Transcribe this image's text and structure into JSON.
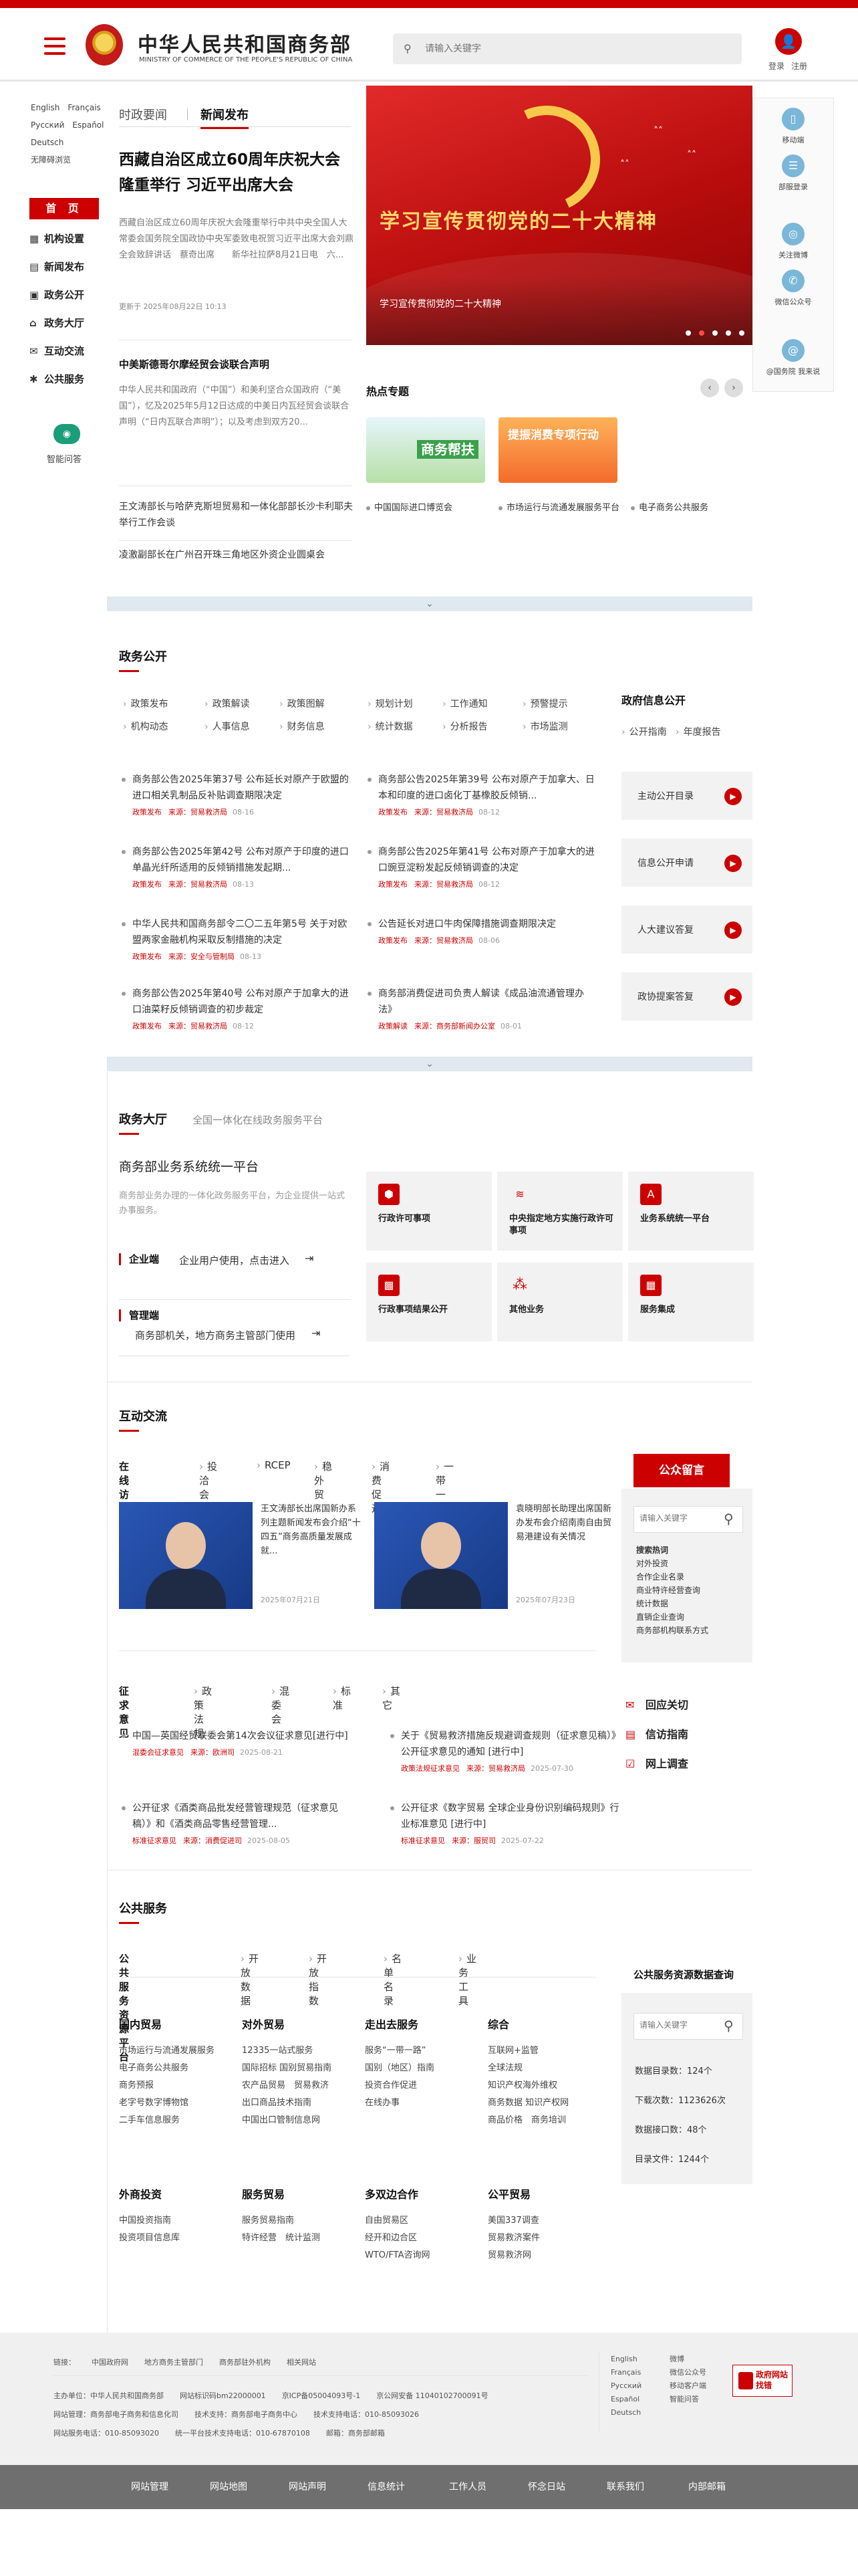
{
  "header": {
    "site_cn": "中华人民共和国商务部",
    "site_en": "MINISTRY OF COMMERCE OF THE PEOPLE'S REPUBLIC OF CHINA",
    "search_placeholder": "请输入关键字",
    "login": "登录",
    "register": "注册"
  },
  "langs": [
    "English",
    "Français",
    "Русский",
    "Español",
    "Deutsch",
    "无障碍浏览"
  ],
  "left_nav": {
    "home": "首 页",
    "items": [
      "机构设置",
      "新闻发布",
      "政务公开",
      "政务大厅",
      "互动交流",
      "公共服务"
    ],
    "ai_label": "智能问答"
  },
  "rail": [
    "移动端",
    "部服登录",
    "关注微博",
    "微信公众号",
    "@国务院 我来说"
  ],
  "news": {
    "tab1": "时政要闻",
    "tab2": "新闻发布",
    "headline": "西藏自治区成立60周年庆祝大会隆重举行 习近平出席大会",
    "desc": "西藏自治区成立60周年庆祝大会隆重举行中共中央全国人大常委会国务院全国政协中央军委致电祝贺习近平出席大会刘鼎全会致辞讲话　蔡奇出席　　新华社拉萨8月21日电　六...",
    "date": "更新于 2025年08月22日 10:13",
    "sub_title": "中美斯德哥尔摩经贸会谈联合声明",
    "sub_desc": "中华人民共和国政府（“中国”）和美利坚合众国政府（“美国”），忆及2025年5月12日达成的中美日内瓦经贸会谈联合声明（“日内瓦联合声明”）；以及考虑到双方20...",
    "link1": "王文涛部长与哈萨克斯坦贸易和一体化部部长沙卡利耶夫举行工作会谈",
    "link2": "凌激副部长在广州召开珠三角地区外资企业圆桌会"
  },
  "banner": {
    "title": "学习宣传贯彻党的二十大精神",
    "caption": "学习宣传贯彻党的二十大精神"
  },
  "hot": {
    "title": "热点专题",
    "card1": "商务帮扶",
    "card2": "提振消费专项行动",
    "links": [
      "中国国际进口博览会",
      "市场运行与流通发展服务平台",
      "电子商务公共服务"
    ]
  },
  "gov": {
    "title": "政务公开",
    "cats": [
      "政策发布",
      "政策解读",
      "政策图解",
      "规划计划",
      "工作通知",
      "预警提示",
      "机构动态",
      "人事信息",
      "财务信息",
      "统计数据",
      "分析报告",
      "市场监测"
    ],
    "items": [
      {
        "t": "商务部公告2025年第37号 公布延长对原产于欧盟的进口相关乳制品反补贴调查期限决定",
        "m1": "政策发布",
        "m2": "来源：贸易救济局",
        "d": "08-16"
      },
      {
        "t": "商务部公告2025年第39号 公布对原产于加拿大、日本和印度的进口卤化丁基橡胶反倾销...",
        "m1": "政策发布",
        "m2": "来源：贸易救济局",
        "d": "08-12"
      },
      {
        "t": "商务部公告2025年第42号 公布对原产于印度的进口单晶光纤所适用的反倾销措施发起期...",
        "m1": "政策发布",
        "m2": "来源：贸易救济局",
        "d": "08-13"
      },
      {
        "t": "商务部公告2025年第41号 公布对原产于加拿大的进口豌豆淀粉发起反倾销调查的决定",
        "m1": "政策发布",
        "m2": "来源：贸易救济局",
        "d": "08-12"
      },
      {
        "t": "中华人民共和国商务部令二〇二五年第5号 关于对欧盟两家金融机构采取反制措施的决定",
        "m1": "政策发布",
        "m2": "来源：安全与管制局",
        "d": "08-13"
      },
      {
        "t": "公告延长对进口牛肉保障措施调查期限决定",
        "m1": "政策发布",
        "m2": "来源：贸易救济局",
        "d": "08-06"
      },
      {
        "t": "商务部公告2025年第40号 公布对原产于加拿大的进口油菜籽反倾销调查的初步裁定",
        "m1": "政策发布",
        "m2": "来源：贸易救济局",
        "d": "08-12"
      },
      {
        "t": "商务部消费促进司负责人解读《成品油流通管理办法》",
        "m1": "政策解读",
        "m2": "来源：商务部新闻办公室",
        "d": "08-01"
      }
    ]
  },
  "info_open": {
    "title": "政府信息公开",
    "links": [
      "公开指南",
      "年度报告"
    ],
    "buttons": [
      "主动公开目录",
      "信息公开申请",
      "人大建议答复",
      "政协提案答复"
    ]
  },
  "hall": {
    "title": "政务大厅",
    "subtitle": "全国一体化在线政务服务平台",
    "system": "商务部业务系统统一平台",
    "desc": "商务部业务办理的一体化政务服务平台，为企业提供一站式办事服务。",
    "enterprise": "企业端",
    "enterprise_desc": "企业用户使用，点击进入",
    "admin": "管理端",
    "admin_desc": "商务部机关，地方商务主管部门使用",
    "tiles": [
      "行政许可事项",
      "中央指定地方实施行政许可事项",
      "业务系统统一平台",
      "行政事项结果公开",
      "其他业务",
      "服务集成"
    ]
  },
  "interact": {
    "title": "互动交流",
    "tab": "在线访谈",
    "tabs": [
      "投洽会",
      "RCEP",
      "稳外贸",
      "消费促进",
      "一带一路"
    ],
    "interviews": [
      {
        "t": "王文涛部长出席国新办系列主题新闻发布会介绍“十四五”商务高质量发展成就...",
        "d": "2025年07月21日"
      },
      {
        "t": "袁晓明部长助理出席国新办发布会介绍南南自由贸易港建设有关情况",
        "d": "2025年07月23日"
      }
    ],
    "op_tab": "征求意见",
    "op_tabs": [
      "政策法规",
      "混委会",
      "标准",
      "其它"
    ],
    "opinions": [
      {
        "t": "中国—英国经贸联委会第14次会议征求意见[进行中]",
        "m1": "混委会征求意见",
        "m2": "来源：欧洲司",
        "d": "2025-08-21"
      },
      {
        "t": "关于《贸易救济措施反规避调查规则（征求意见稿）》公开征求意见的通知 [进行中]",
        "m1": "政策法规征求意见",
        "m2": "来源：贸易救济局",
        "d": "2025-07-30"
      },
      {
        "t": "公开征求《酒类商品批发经营管理规范（征求意见稿）》和《酒类商品零售经营管理...",
        "m1": "标准征求意见",
        "m2": "来源：消费促进司",
        "d": "2025-08-05"
      },
      {
        "t": "公开征求《数字贸易 全球企业身份识别编码规则》行业标准意见 [进行中]",
        "m1": "标准征求意见",
        "m2": "来源：服贸司",
        "d": "2025-07-22"
      }
    ],
    "msg_btn": "公众留言",
    "msg_placeholder": "请输入关键字",
    "msg_links": [
      "搜索热词",
      "对外投资",
      "合作企业名录",
      "商业特许经营查询",
      "统计数据",
      "直销企业查询",
      "商务部机构联系方式"
    ],
    "tools": [
      "回应关切",
      "信访指南",
      "网上调查"
    ]
  },
  "public": {
    "title": "公共服务",
    "tab": "公共服务资源平台",
    "tabs": [
      "开放数据",
      "开放指数",
      "名单名录",
      "业务工具"
    ],
    "cols": [
      {
        "h": "国内贸易",
        "l": [
          "市场运行与流通发展服务",
          "电子商务公共服务",
          "商务预报",
          "老字号数字博物馆",
          "二手车信息服务"
        ]
      },
      {
        "h": "对外贸易",
        "l": [
          "12335一站式服务",
          "国际招标 国别贸易指南",
          "农产品贸易　贸易救济",
          "出口商品技术指南",
          "中国出口管制信息网"
        ]
      },
      {
        "h": "走出去服务",
        "l": [
          "服务“一带一路”",
          "国别（地区）指南",
          "投资合作促进",
          "在线办事"
        ]
      },
      {
        "h": "综合",
        "l": [
          "互联网+监管",
          "全球法规",
          "知识产权海外维权",
          "商务数据 知识产权网",
          "商品价格　商务培训"
        ]
      },
      {
        "h": "外商投资",
        "l": [
          "中国投资指南",
          "投资项目信息库"
        ]
      },
      {
        "h": "服务贸易",
        "l": [
          "服务贸易指南",
          "特许经营　统计监测"
        ]
      },
      {
        "h": "多双边合作",
        "l": [
          "自由贸易区",
          "经开和边合区",
          "WTO/FTA咨询网"
        ]
      },
      {
        "h": "公平贸易",
        "l": [
          "美国337调查",
          "贸易救济案件",
          "贸易救济网"
        ]
      }
    ],
    "dq_title": "公共服务资源数据查询",
    "dq_placeholder": "请输入关键字",
    "stats": [
      "数据目录数：124个",
      "下载次数：1123626次",
      "数据接口数：48个",
      "目录文件：1244个"
    ]
  },
  "footer": {
    "links_label": "链接：",
    "links": [
      "中国政府网",
      "地方商务主管部门",
      "商务部驻外机构",
      "相关网站"
    ],
    "line2": [
      "主办单位：中华人民共和国商务部",
      "网站标识码bm22000001",
      "京ICP备05004093号-1",
      "京公网安备 11040102700091号"
    ],
    "line3": [
      "网站管理：商务部电子商务和信息化司",
      "技术支持：商务部电子商务中心",
      "技术支持电话：010-85093026"
    ],
    "line4": [
      "网站服务电话：010-85093020",
      "统一平台技术支持电话：010-67870108",
      "邮箱：商务部邮箱"
    ],
    "langs": [
      "English",
      "Français",
      "Русский",
      "Español",
      "Deutsch"
    ],
    "apps": [
      "微博",
      "微信公众号",
      "移动客户端",
      "智能问答"
    ],
    "badge": "政府网站找错",
    "bottom": [
      "网站管理",
      "网站地图",
      "网站声明",
      "信息统计",
      "工作人员",
      "怀念日站",
      "联系我们",
      "内部邮箱"
    ]
  }
}
